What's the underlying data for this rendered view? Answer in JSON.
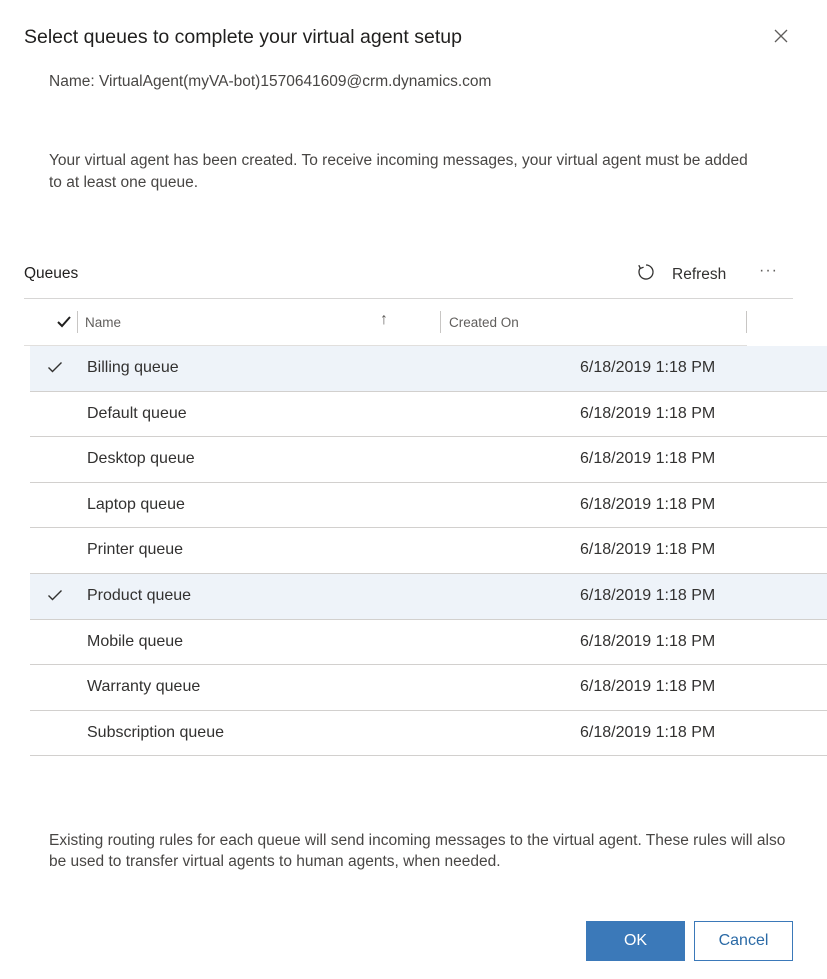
{
  "dialog": {
    "title": "Select queues to complete your virtual agent setup",
    "name_line": "Name: VirtualAgent(myVA-bot)1570641609@crm.dynamics.com",
    "description": "Your virtual agent has been created. To receive incoming messages, your virtual agent must be added to at least one queue.",
    "footer_note": "Existing routing rules for each queue will send incoming messages to the virtual agent. These rules will also be used to transfer virtual agents to human agents, when needed."
  },
  "grid": {
    "label": "Queues",
    "refresh_label": "Refresh",
    "more_label": "···",
    "columns": {
      "name": "Name",
      "created_on": "Created On"
    },
    "rows": [
      {
        "name": "Billing queue",
        "created_on": "6/18/2019 1:18 PM",
        "selected": true
      },
      {
        "name": "Default queue",
        "created_on": "6/18/2019 1:18 PM",
        "selected": false
      },
      {
        "name": "Desktop queue",
        "created_on": "6/18/2019 1:18 PM",
        "selected": false
      },
      {
        "name": "Laptop queue",
        "created_on": "6/18/2019 1:18 PM",
        "selected": false
      },
      {
        "name": "Printer queue",
        "created_on": "6/18/2019 1:18 PM",
        "selected": false
      },
      {
        "name": "Product queue",
        "created_on": "6/18/2019 1:18 PM",
        "selected": true
      },
      {
        "name": "Mobile queue",
        "created_on": "6/18/2019 1:18 PM",
        "selected": false
      },
      {
        "name": "Warranty queue",
        "created_on": "6/18/2019 1:18 PM",
        "selected": false
      },
      {
        "name": "Subscription queue",
        "created_on": "6/18/2019 1:18 PM",
        "selected": false
      }
    ]
  },
  "buttons": {
    "ok": "OK",
    "cancel": "Cancel"
  },
  "icons": {
    "close": "close-icon",
    "refresh": "refresh-icon",
    "check": "checkmark-icon",
    "sort": "sort-ascending-icon"
  },
  "colors": {
    "primary": "#3b79b9",
    "selected_row": "#eef3f9"
  }
}
